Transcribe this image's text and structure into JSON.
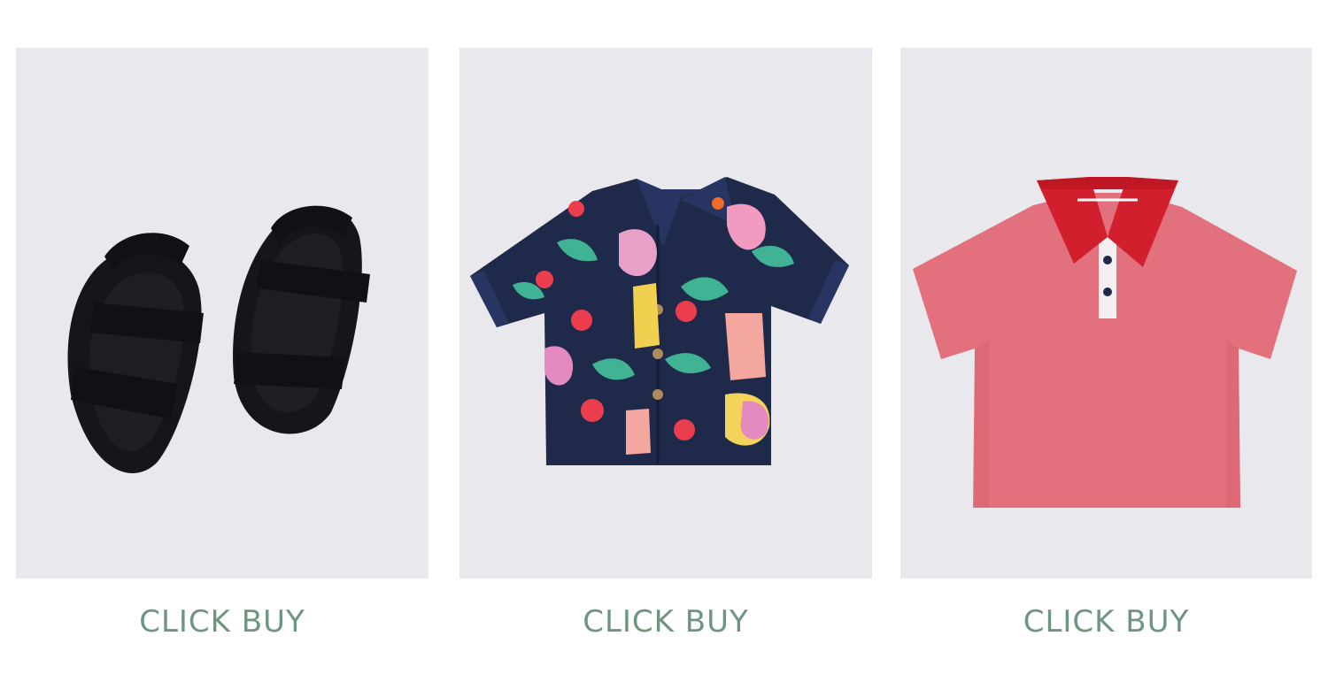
{
  "products": [
    {
      "id": "sandals",
      "image": "black-sandals",
      "cta_label": "CLICK BUY"
    },
    {
      "id": "print-shirt",
      "image": "navy-print-shirt",
      "cta_label": "CLICK BUY"
    },
    {
      "id": "polo",
      "image": "pink-polo-shirt",
      "cta_label": "CLICK BUY"
    }
  ],
  "colors": {
    "card_bg": "#e9e8ed",
    "cta": "#6e9580",
    "sandal": "#15161a",
    "shirt_navy": "#1f2a4a",
    "polo_pink": "#e2707d",
    "polo_collar": "#d21f2e"
  }
}
